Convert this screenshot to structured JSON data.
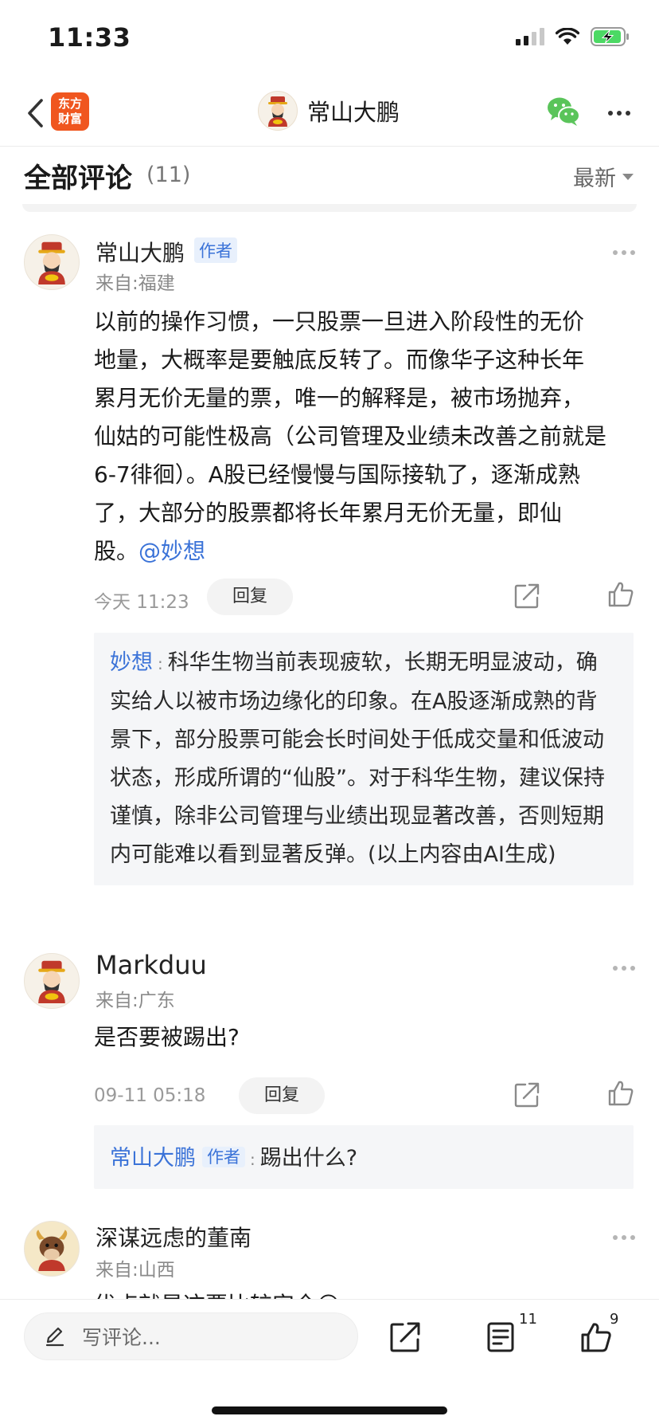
{
  "status_bar": {
    "time": "11:33"
  },
  "nav": {
    "logo_line1": "东方",
    "logo_line2": "财富",
    "title": "常山大鹏"
  },
  "comments_header": {
    "title": "全部评论",
    "count": "(11)",
    "sort": "最新"
  },
  "comments": [
    {
      "name": "常山大鹏",
      "tag": "作者",
      "location": "来自:福建",
      "text_lines": [
        "以前的操作习惯，一只股票一旦进入阶段性的无价",
        "地量，大概率是要触底反转了。而像华子这种长年",
        "累月无价无量的票，唯一的解释是，被市场抛弃，",
        "仙姑的可能性极高（公司管理及业绩未改善之前就是",
        "6-7徘徊）。A股已经慢慢与国际接轨了，逐渐成熟",
        "了，大部分的股票都将长年累月无价无量，即仙"
      ],
      "last_line": "股。",
      "mention": "@妙想",
      "time": "今天 11:23",
      "reply_label": "回复",
      "reply": {
        "author": "妙想",
        "text": "科华生物当前表现疲软，长期无明显波动，确实给人以被市场边缘化的印象。在A股逐渐成熟的背景下，部分股票可能会长时间处于低成交量和低波动状态，形成所谓的“仙股”。对于科华生物，建议保持谨慎，除非公司管理与业绩出现显著改善，否则短期内可能难以看到显著反弹。(以上内容由AI生成)"
      }
    },
    {
      "name": "Markduu",
      "location": "来自:广东",
      "text": "是否要被踢出?",
      "time": "09-11 05:18",
      "reply_label": "回复",
      "reply": {
        "author": "常山大鹏",
        "tag": "作者",
        "text": "踢出什么?"
      }
    },
    {
      "name": "深谋远虑的董南",
      "location": "来自:山西",
      "text": "优点就是这票比较安全😊"
    }
  ],
  "bottom_bar": {
    "placeholder": "写评论...",
    "comment_count": "11",
    "like_count": "9"
  }
}
